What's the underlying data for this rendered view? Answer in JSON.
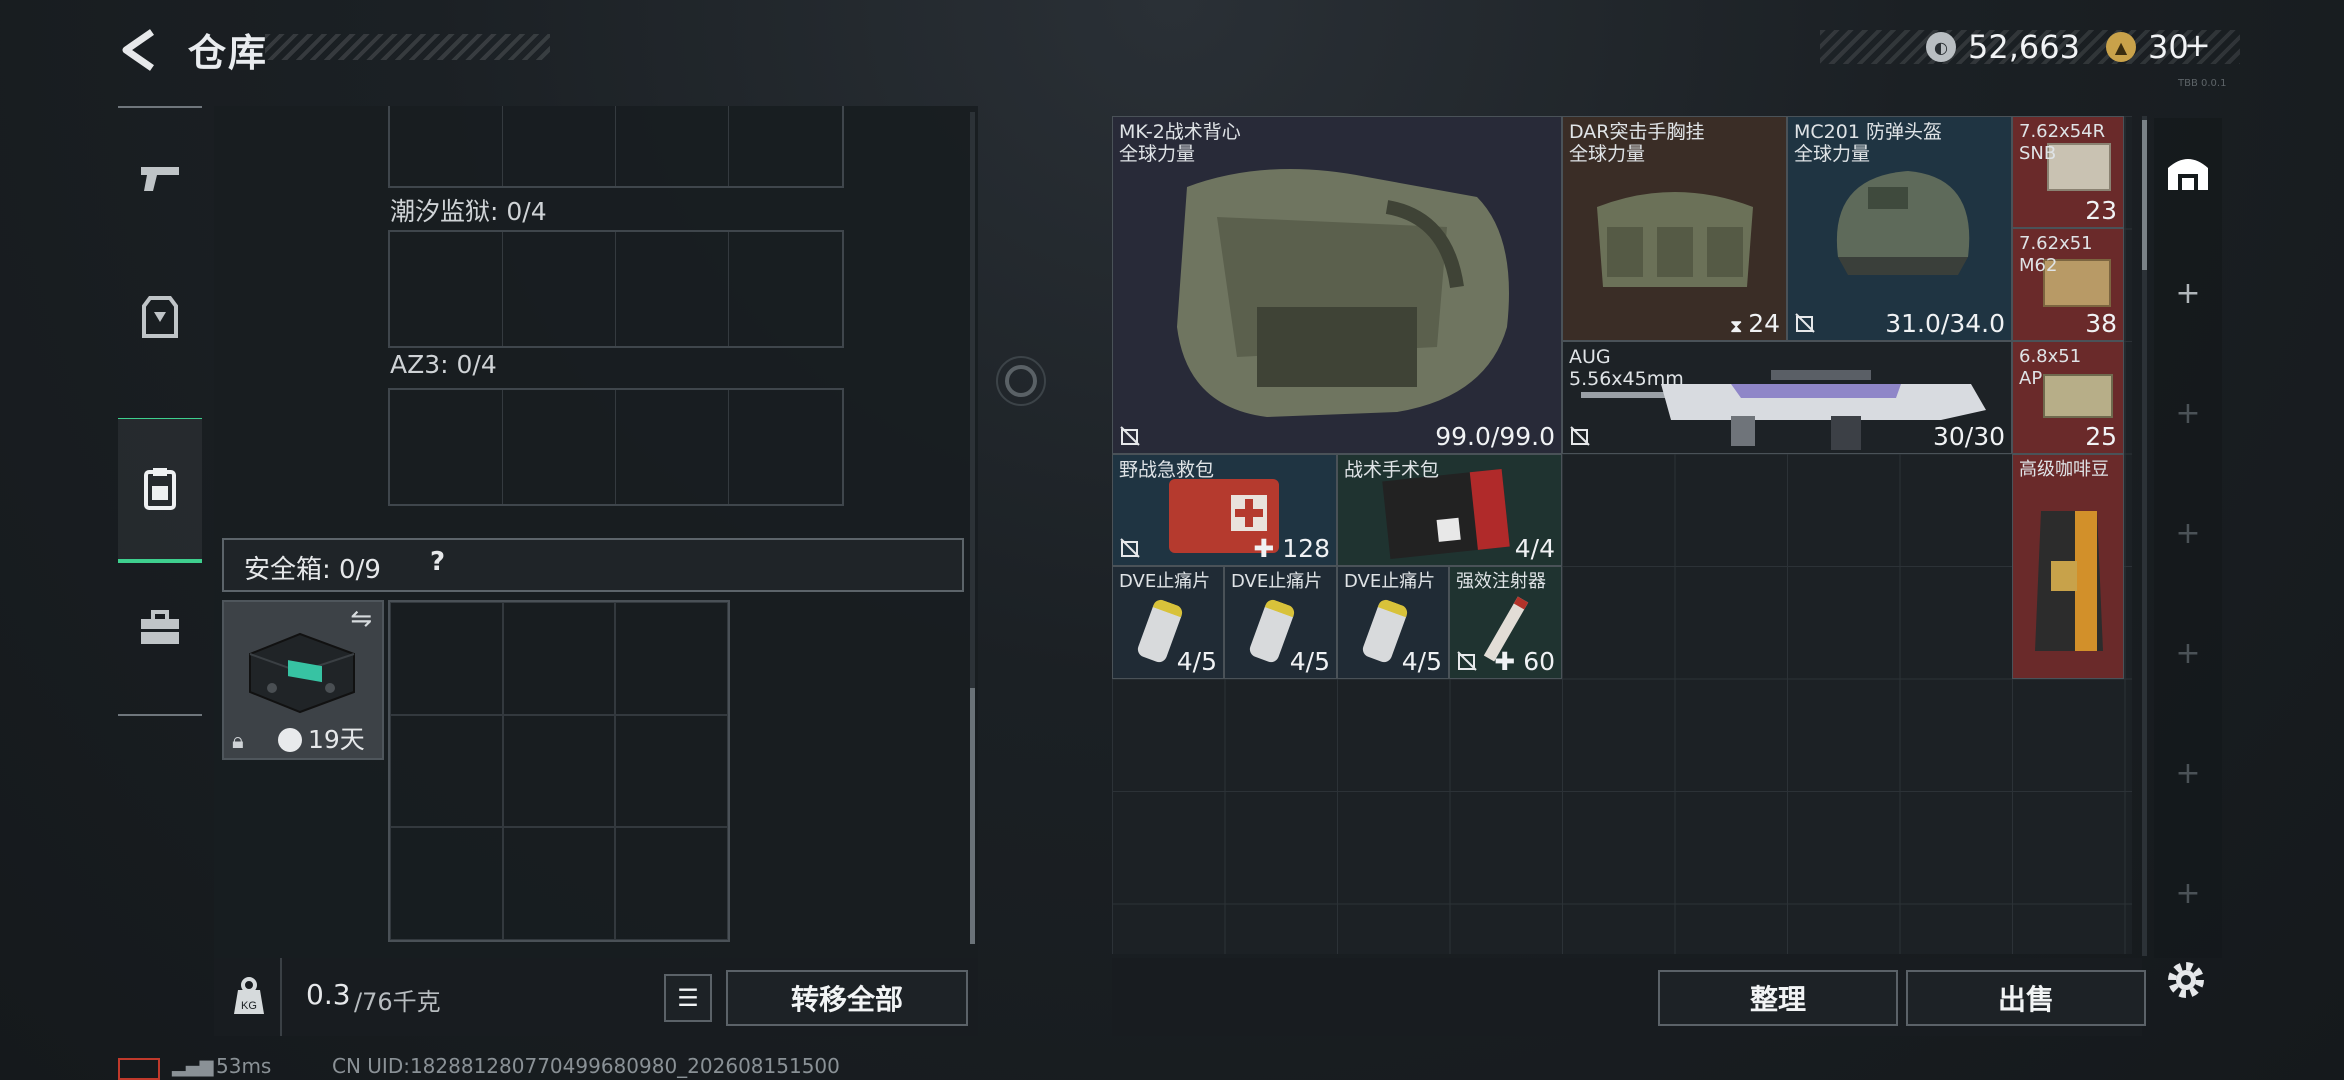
{
  "header": {
    "title": "仓库",
    "currency1": "52,663",
    "currency2": "30",
    "currency2_suffix": "+",
    "top_right_tag": "TBB 0.0.1"
  },
  "left_tabs": [
    {
      "icon": "pistol-icon"
    },
    {
      "icon": "armor-icon"
    },
    {
      "icon": "backpack-icon",
      "active": true
    },
    {
      "icon": "briefcase-icon"
    }
  ],
  "containers": [
    {
      "label": ""
    },
    {
      "label": "潮汐监狱: 0/4"
    },
    {
      "label": "AZ3: 0/4"
    }
  ],
  "safe_box": {
    "label": "安全箱: 0/9",
    "help": "?",
    "timer": "19天"
  },
  "left_footer": {
    "weight": "0.3",
    "weight_max": "/76千克",
    "transfer_all": "转移全部"
  },
  "items": [
    {
      "id": "vest",
      "name": "MK-2战术背心",
      "sub": "全球力量",
      "value": "99.0/99.0"
    },
    {
      "id": "rig",
      "name": "DAR突击手胸挂",
      "sub": "全球力量",
      "value": "24"
    },
    {
      "id": "helmet",
      "name": "MC201 防弹头盔",
      "sub": "全球力量",
      "value": "31.0/34.0"
    },
    {
      "id": "ammo1",
      "name": "7.62x54R",
      "sub": "SNB",
      "value": "23"
    },
    {
      "id": "ammo2",
      "name": "7.62x51",
      "sub": "M62",
      "value": "38"
    },
    {
      "id": "ammo3",
      "name": "6.8x51",
      "sub": "AP",
      "value": "25"
    },
    {
      "id": "gun",
      "name": "AUG",
      "sub": "5.56x45mm",
      "value": "30/30"
    },
    {
      "id": "coffee",
      "name": "高级咖啡豆",
      "sub": "",
      "value": ""
    },
    {
      "id": "medkit",
      "name": "野战急救包",
      "sub": "",
      "value": "128"
    },
    {
      "id": "surgery",
      "name": "战术手术包",
      "sub": "",
      "value": "4/4"
    },
    {
      "id": "dve1",
      "name": "DVE止痛片",
      "sub": "",
      "value": "4/5"
    },
    {
      "id": "dve2",
      "name": "DVE止痛片",
      "sub": "",
      "value": "4/5"
    },
    {
      "id": "dve3",
      "name": "DVE止痛片",
      "sub": "",
      "value": "4/5"
    },
    {
      "id": "injector",
      "name": "强效注射器",
      "sub": "",
      "value": "60"
    }
  ],
  "right_footer": {
    "sort": "整理",
    "sell": "出售"
  },
  "status": {
    "ping": "53ms",
    "uid": "CN UID:182881280770499680980_202608151500"
  },
  "colors": {
    "accent_green": "#3ecf8e",
    "rare_red": "#6a2a2a",
    "rare_blue": "#1f3442",
    "rare_brown": "#3a2d26",
    "rare_purple": "#2a2a3c",
    "rare_green": "#1f3330"
  }
}
